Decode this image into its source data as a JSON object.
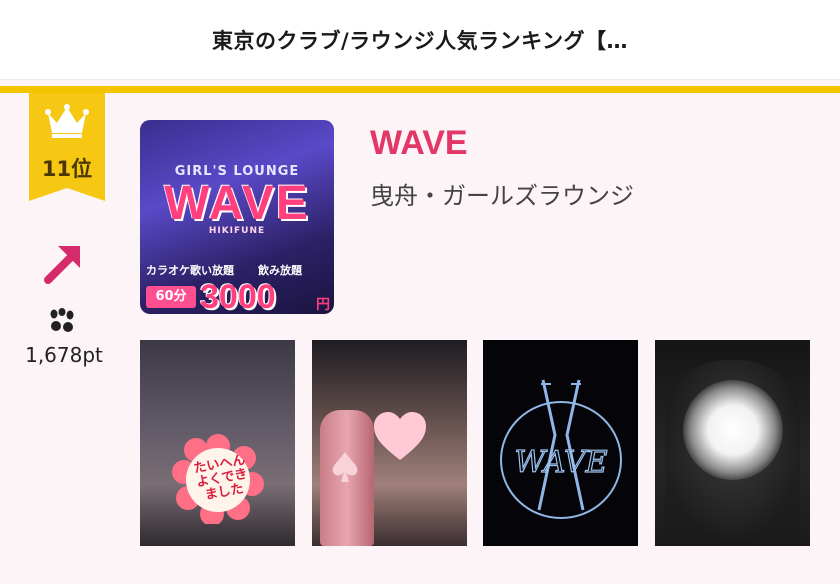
{
  "header": {
    "title": "東京のクラブ/ラウンジ人気ランキング【…"
  },
  "colors": {
    "accent": "#f5c400",
    "brand": "#e33867",
    "background": "#fdf4f7"
  },
  "rank": {
    "label": "11位",
    "trend_icon": "arrow-up-right-icon",
    "crown_icon": "crown-icon"
  },
  "points": {
    "paw_icon": "paw-icon",
    "value": "1,678pt"
  },
  "shop": {
    "name": "WAVE",
    "genre": "曳舟・ガールズラウンジ",
    "main_image": {
      "lounge_text": "GIRL'S LOUNGE",
      "logo_text": "WAVE",
      "sub_text": "HIKIFUNE",
      "karaoke_text": "カラオケ歌い放題",
      "drink_text": "飲み放題",
      "duration_text": "60分",
      "price_text": "3000",
      "yen_text": "円"
    },
    "photos": [
      {
        "sticker_text": "たいへんよくできました"
      },
      {},
      {
        "logo_text": "WAVE"
      },
      {}
    ]
  }
}
